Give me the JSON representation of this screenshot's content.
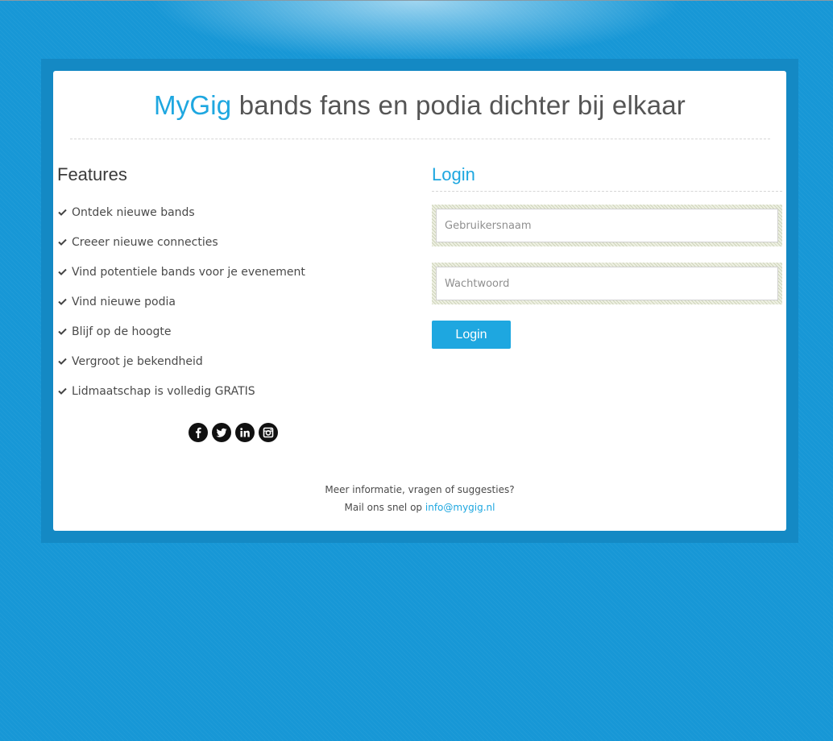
{
  "header": {
    "brand": "MyGig",
    "tagline": "bands fans en podia dichter bij elkaar"
  },
  "features": {
    "title": "Features",
    "items": [
      "Ontdek nieuwe bands",
      "Creeer nieuwe connecties",
      "Vind potentiele bands voor je evenement",
      "Vind nieuwe podia",
      "Blijf op de hoogte",
      "Vergroot je bekendheid",
      "Lidmaatschap is volledig GRATIS"
    ],
    "item_icon": "check-icon"
  },
  "social": {
    "icons": [
      "facebook-icon",
      "twitter-icon",
      "linkedin-icon",
      "instagram-icon"
    ]
  },
  "login": {
    "title": "Login",
    "username_placeholder": "Gebruikersnaam",
    "username_value": "",
    "password_placeholder": "Wachtwoord",
    "password_value": "",
    "button_label": "Login"
  },
  "footer": {
    "line1": "Meer informatie, vragen of suggesties?",
    "line2_prefix": "Mail ons snel op",
    "email": "info@mygig.nl"
  },
  "colors": {
    "background": "#1797d6",
    "frame": "#1489c4",
    "accent": "#1ea7e0",
    "text": "#4a4a4a"
  }
}
